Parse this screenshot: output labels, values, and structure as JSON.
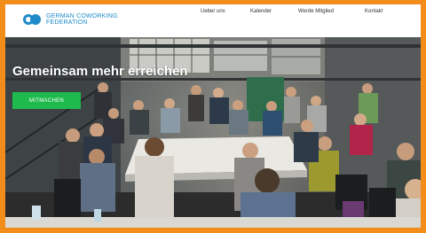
{
  "brand": {
    "line1": "GERMAN COWORKING",
    "line2": "FEDERATION"
  },
  "nav": {
    "items": [
      {
        "label": "Ueber uns"
      },
      {
        "label": "Kalender"
      },
      {
        "label": "Werde Mitglied"
      },
      {
        "label": "Kontakt"
      }
    ]
  },
  "hero": {
    "title": "Gemeinsam mehr erreichen",
    "cta_label": "MITMACHEN"
  },
  "colors": {
    "frame": "#f28c1b",
    "brand": "#1e8ac9",
    "cta": "#1fba4e"
  }
}
